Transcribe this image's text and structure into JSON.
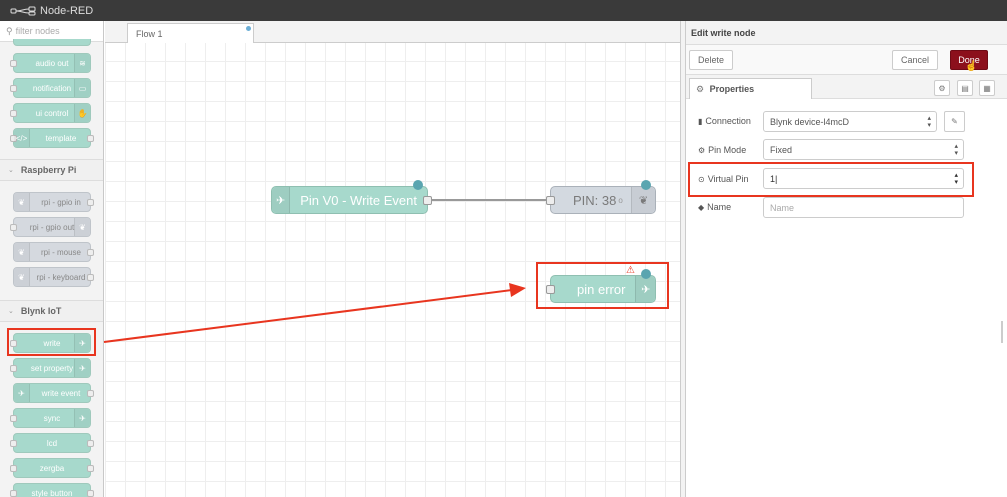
{
  "header": {
    "app_title": "Node-RED"
  },
  "palette": {
    "search_placeholder": "filter nodes",
    "nodes_top": [
      {
        "label": "audio out",
        "style": "teal"
      },
      {
        "label": "notification",
        "style": "teal"
      },
      {
        "label": "ui control",
        "style": "teal"
      },
      {
        "label": "template",
        "style": "teal"
      }
    ],
    "categories": {
      "raspberry": "Raspberry Pi",
      "blynk": "Blynk IoT"
    },
    "raspberry_nodes": [
      {
        "label": "rpi - gpio in"
      },
      {
        "label": "rpi - gpio out"
      },
      {
        "label": "rpi - mouse"
      },
      {
        "label": "rpi - keyboard"
      }
    ],
    "blynk_nodes": [
      {
        "label": "write"
      },
      {
        "label": "set property"
      },
      {
        "label": "write event"
      },
      {
        "label": "sync"
      },
      {
        "label": "lcd"
      },
      {
        "label": "zergba"
      },
      {
        "label": "style button"
      }
    ]
  },
  "workspace": {
    "tab_label": "Flow 1",
    "nodes": {
      "write_event": "Pin V0 - Write Event",
      "pin_debug": "PIN: 38",
      "pin_debug_suffix": "o",
      "pin_error": "pin error"
    },
    "warning_icon": "⚠"
  },
  "editor": {
    "title": "Edit write node",
    "delete_label": "Delete",
    "cancel_label": "Cancel",
    "done_label": "Done",
    "tab_properties": "Properties",
    "fields": {
      "connection_label": "Connection",
      "connection_value": "Blynk device-l4mcD",
      "pin_mode_label": "Pin Mode",
      "pin_mode_value": "Fixed",
      "virtual_pin_label": "Virtual Pin",
      "virtual_pin_value": "1",
      "name_label": "Name",
      "name_placeholder": "Name"
    }
  },
  "colors": {
    "accent_red": "#e8351f",
    "done_button": "#8c101c",
    "node_teal": "#a7d9cc",
    "node_gray": "#d3d9e0",
    "header_bg": "#3a3a3a"
  }
}
